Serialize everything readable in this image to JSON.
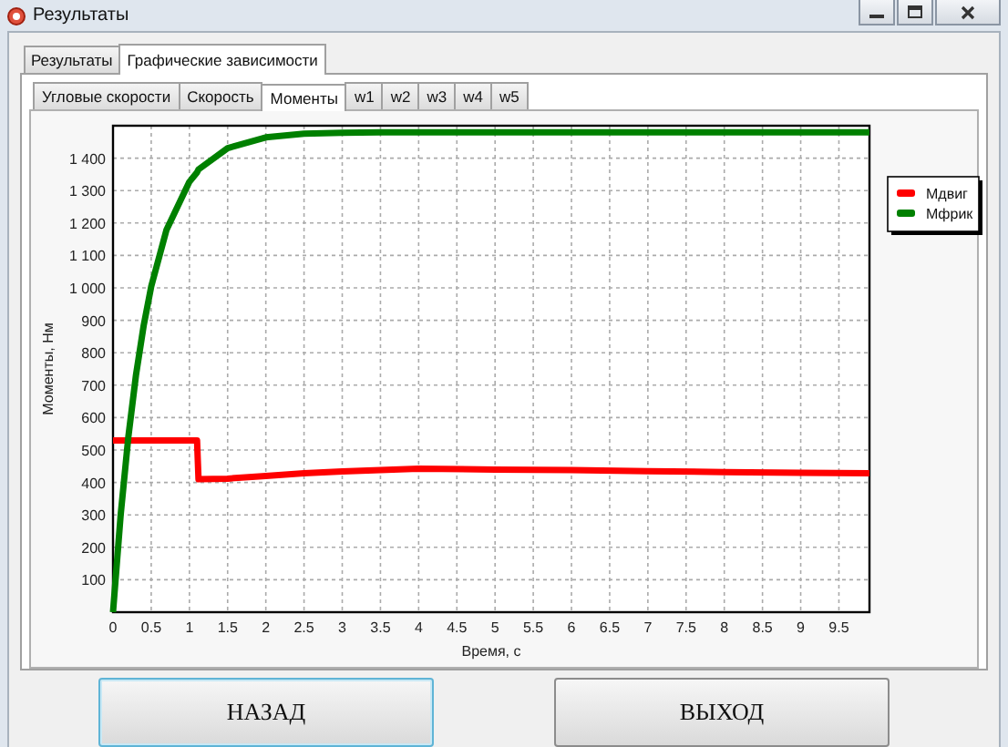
{
  "window": {
    "title": "Результаты"
  },
  "tabs": [
    {
      "label": "Результаты",
      "selected": false
    },
    {
      "label": "Графические зависимости",
      "selected": true
    }
  ],
  "subtabs": [
    {
      "label": "Угловые скорости",
      "selected": false
    },
    {
      "label": "Скорость",
      "selected": false
    },
    {
      "label": "Моменты",
      "selected": true
    },
    {
      "label": "w1",
      "selected": false
    },
    {
      "label": "w2",
      "selected": false
    },
    {
      "label": "w3",
      "selected": false
    },
    {
      "label": "w4",
      "selected": false
    },
    {
      "label": "w5",
      "selected": false
    }
  ],
  "chart": {
    "chart_data": {
      "type": "line",
      "xlabel": "Время, с",
      "ylabel": "Моменты, Нм",
      "x": [
        0,
        0.1,
        0.2,
        0.3,
        0.4,
        0.5,
        0.7,
        1,
        1.1,
        1.12,
        1.5,
        2,
        2.5,
        3,
        3.5,
        4,
        5,
        6,
        7,
        8,
        9,
        9.9
      ],
      "series": [
        {
          "name": "Мдвиг",
          "color": "#ff0000",
          "values": [
            530,
            530,
            530,
            530,
            530,
            530,
            530,
            530,
            530,
            410,
            412,
            420,
            428,
            434,
            438,
            442,
            440,
            438,
            435,
            432,
            430,
            428
          ]
        },
        {
          "name": "Мфрик",
          "color": "#008000",
          "values": [
            0,
            300,
            540,
            731,
            883,
            1005,
            1178,
            1327,
            1356,
            1365,
            1431,
            1464,
            1475,
            1478,
            1480,
            1480,
            1480,
            1480,
            1480,
            1480,
            1480,
            1480
          ]
        }
      ],
      "grid": true,
      "legend": true,
      "xlim": [
        0,
        9.9
      ],
      "ylim": [
        0,
        1500
      ],
      "xticks": [
        0,
        0.5,
        1,
        1.5,
        2,
        2.5,
        3,
        3.5,
        4,
        4.5,
        5,
        5.5,
        6,
        6.5,
        7,
        7.5,
        8,
        8.5,
        9,
        9.5
      ],
      "yticks": [
        {
          "value": 100,
          "label": "100"
        },
        {
          "value": 200,
          "label": "200"
        },
        {
          "value": 300,
          "label": "300"
        },
        {
          "value": 400,
          "label": "400"
        },
        {
          "value": 500,
          "label": "500"
        },
        {
          "value": 600,
          "label": "600"
        },
        {
          "value": 700,
          "label": "700"
        },
        {
          "value": 800,
          "label": "800"
        },
        {
          "value": 900,
          "label": "900"
        },
        {
          "value": 1000,
          "label": "1 000"
        },
        {
          "value": 1100,
          "label": "1 100"
        },
        {
          "value": 1200,
          "label": "1 200"
        },
        {
          "value": 1300,
          "label": "1 300"
        },
        {
          "value": 1400,
          "label": "1 400"
        }
      ]
    }
  },
  "buttons": [
    {
      "label": "НАЗАД",
      "selected": true
    },
    {
      "label": "ВЫХОД",
      "selected": false
    }
  ]
}
